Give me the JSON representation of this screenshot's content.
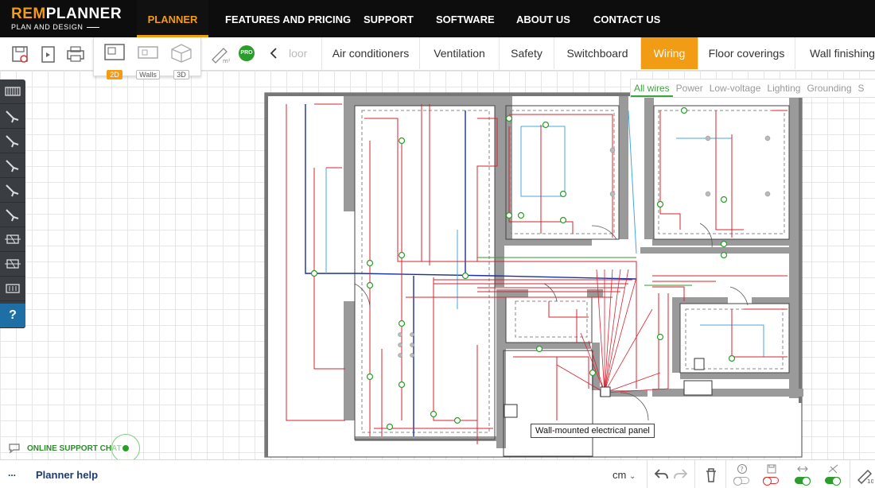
{
  "logo": {
    "name_part1": "REM",
    "name_part2": "PLANNER",
    "tagline": "PLAN AND DESIGN"
  },
  "nav": [
    {
      "label": "PLANNER"
    },
    {
      "label": "FEATURES AND PRICING"
    },
    {
      "label": "SUPPORT"
    },
    {
      "label": "SOFTWARE"
    },
    {
      "label": "ABOUT US"
    },
    {
      "label": "CONTACT US"
    }
  ],
  "views": {
    "v2d": "2D",
    "walls": "Walls",
    "v3d": "3D"
  },
  "pro_badge": "PRO",
  "tabs": [
    {
      "label": "loor"
    },
    {
      "label": "Air conditioners"
    },
    {
      "label": "Ventilation"
    },
    {
      "label": "Safety"
    },
    {
      "label": "Switchboard"
    },
    {
      "label": "Wiring"
    },
    {
      "label": "Floor coverings"
    },
    {
      "label": "Wall finishing"
    }
  ],
  "filters": [
    "All wires",
    "Power",
    "Low-voltage",
    "Lighting",
    "Grounding",
    "S"
  ],
  "left_panel_help": "?",
  "tooltip": "Wall-mounted electrical panel",
  "chat": "ONLINE SUPPORT CHAT",
  "bottom": {
    "dots": "...",
    "help": "Planner help",
    "units": "cm"
  },
  "colors": {
    "accent": "#f29b14",
    "nav_bg": "#0d0d0d",
    "green": "#2a9d2a",
    "power_wire": "#d9232e",
    "lighting_wire": "#44a8e0",
    "low_voltage_wire": "#1c2f9e"
  }
}
